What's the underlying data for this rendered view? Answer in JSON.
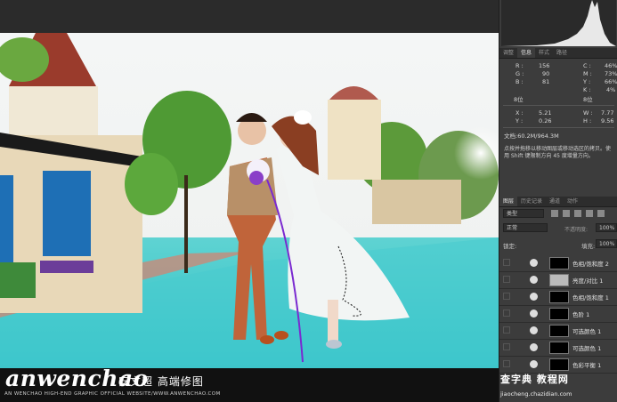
{
  "watermark": {
    "brand": "anwenchao",
    "chinese": "安文超 高端修图",
    "subtitle": "AN WENCHAO HIGH-END GRAPHIC OFFICIAL WEBSITE/WWW.ANWENCHAO.COM"
  },
  "panel": {
    "top_tabs": [
      "调整",
      "信息",
      "样式",
      "路径"
    ],
    "info": {
      "r_label": "R :",
      "r_val": "156",
      "g_label": "G :",
      "g_val": "90",
      "b_label": "B :",
      "b_val": "81",
      "c_label": "C :",
      "c_val": "46%",
      "m_label": "M :",
      "m_val": "73%",
      "y_label": "Y :",
      "y_val": "66%",
      "k_label": "K :",
      "k_val": "4%",
      "bits_left": "8位",
      "bits_right": "8位",
      "x_label": "X :",
      "x_val": "5.21",
      "y2_label": "Y :",
      "y2_val": "0.26",
      "w_label": "W :",
      "w_val": "7.77",
      "h_label": "H :",
      "h_val": "9.56"
    },
    "doc": "文档:60.2M/964.3M",
    "hint": "点按并拖移以移动图层或移动选区的拷贝。使用 Shift 键限制方向 45 度增量方向。",
    "layer_tabs": [
      "图层",
      "历史记录",
      "通道",
      "动作"
    ],
    "kind": "类型",
    "blend": "正常",
    "opacity_label": "不透明度:",
    "opacity": "100%",
    "lock_label": "锁定:",
    "fill_label": "填充:",
    "fill": "100%",
    "layers": [
      {
        "name": "色相/饱和度 2"
      },
      {
        "name": "亮度/对比 1"
      },
      {
        "name": "色相/饱和度 1"
      },
      {
        "name": "色阶 1"
      },
      {
        "name": "可选颜色 1"
      },
      {
        "name": "可选颜色 1"
      },
      {
        "name": "色彩平衡 1"
      }
    ],
    "site_name": "查字典 教程网",
    "site_url": "jiaocheng.chazidian.com"
  }
}
